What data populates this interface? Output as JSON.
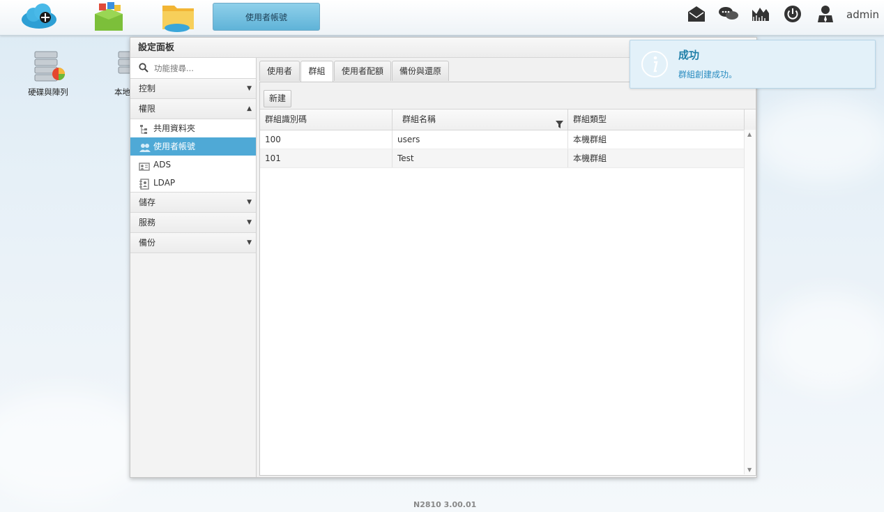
{
  "topbar": {
    "active_app_tab": "使用者帳號",
    "user": "admin"
  },
  "desktop": {
    "icons": [
      {
        "label": "硬碟與陣列"
      },
      {
        "label": "本地"
      }
    ]
  },
  "panel": {
    "title": "設定面板",
    "search_placeholder": "功能搜尋...",
    "sections": [
      {
        "label": "控制",
        "expanded": false
      },
      {
        "label": "權限",
        "expanded": true,
        "items": [
          "共用資料夾",
          "使用者帳號",
          "ADS",
          "LDAP"
        ]
      },
      {
        "label": "儲存",
        "expanded": false
      },
      {
        "label": "服務",
        "expanded": false
      },
      {
        "label": "備份",
        "expanded": false
      }
    ],
    "active_item": "使用者帳號"
  },
  "content": {
    "tabs": [
      "使用者",
      "群組",
      "使用者配額",
      "備份與還原"
    ],
    "active_tab": "群組",
    "new_button": "新建",
    "columns": [
      "群組識別碼",
      "群組名稱",
      "群組類型"
    ],
    "rows": [
      [
        "100",
        "users",
        "本機群組"
      ],
      [
        "101",
        "Test",
        "本機群組"
      ]
    ]
  },
  "notification": {
    "title": "成功",
    "message": "群組創建成功。"
  },
  "footer": {
    "version": "N2810   3.00.01"
  },
  "colors": {
    "accent": "#4fa9d6",
    "app_tab": "#6fbfe0",
    "notify_bg": "#e3f1f9"
  }
}
